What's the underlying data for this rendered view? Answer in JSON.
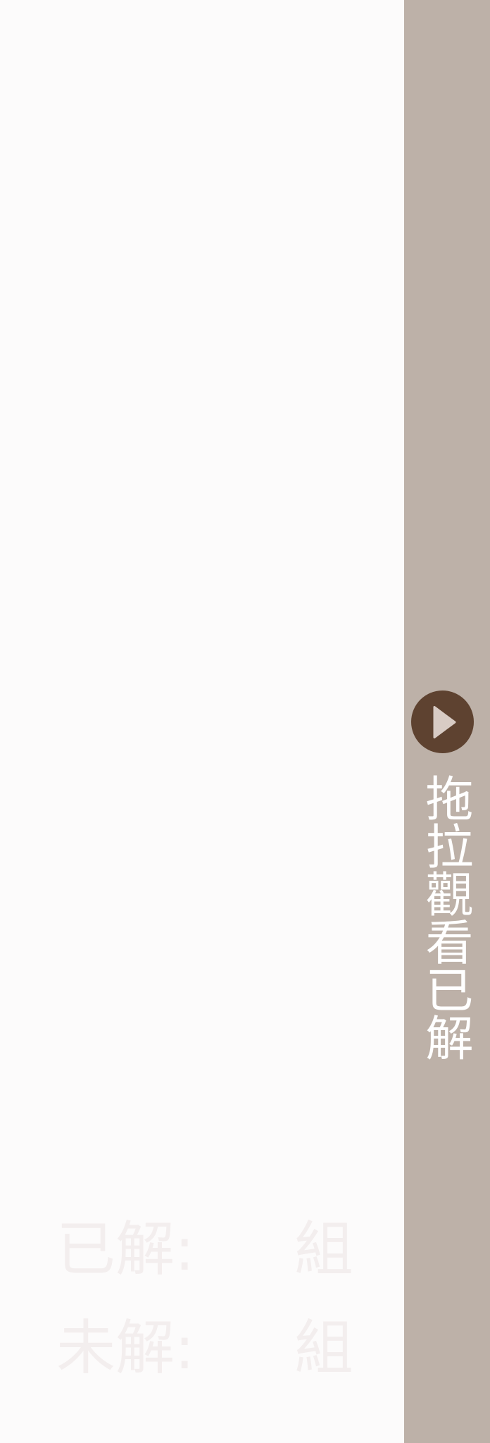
{
  "stats": {
    "solved_label": "已解:",
    "solved_value": "",
    "solved_unit": "組",
    "unsolved_label": "未解:",
    "unsolved_value": "",
    "unsolved_unit": "組"
  },
  "drag_panel": {
    "play_icon": "play-triangle-icon",
    "label": "拖拉觀看已解"
  },
  "colors": {
    "background": "#fcfbfb",
    "panel": "#bdb1a8",
    "play_button": "#5e4230",
    "label_text": "#ffffff",
    "faint_text": "#f3eeee"
  }
}
